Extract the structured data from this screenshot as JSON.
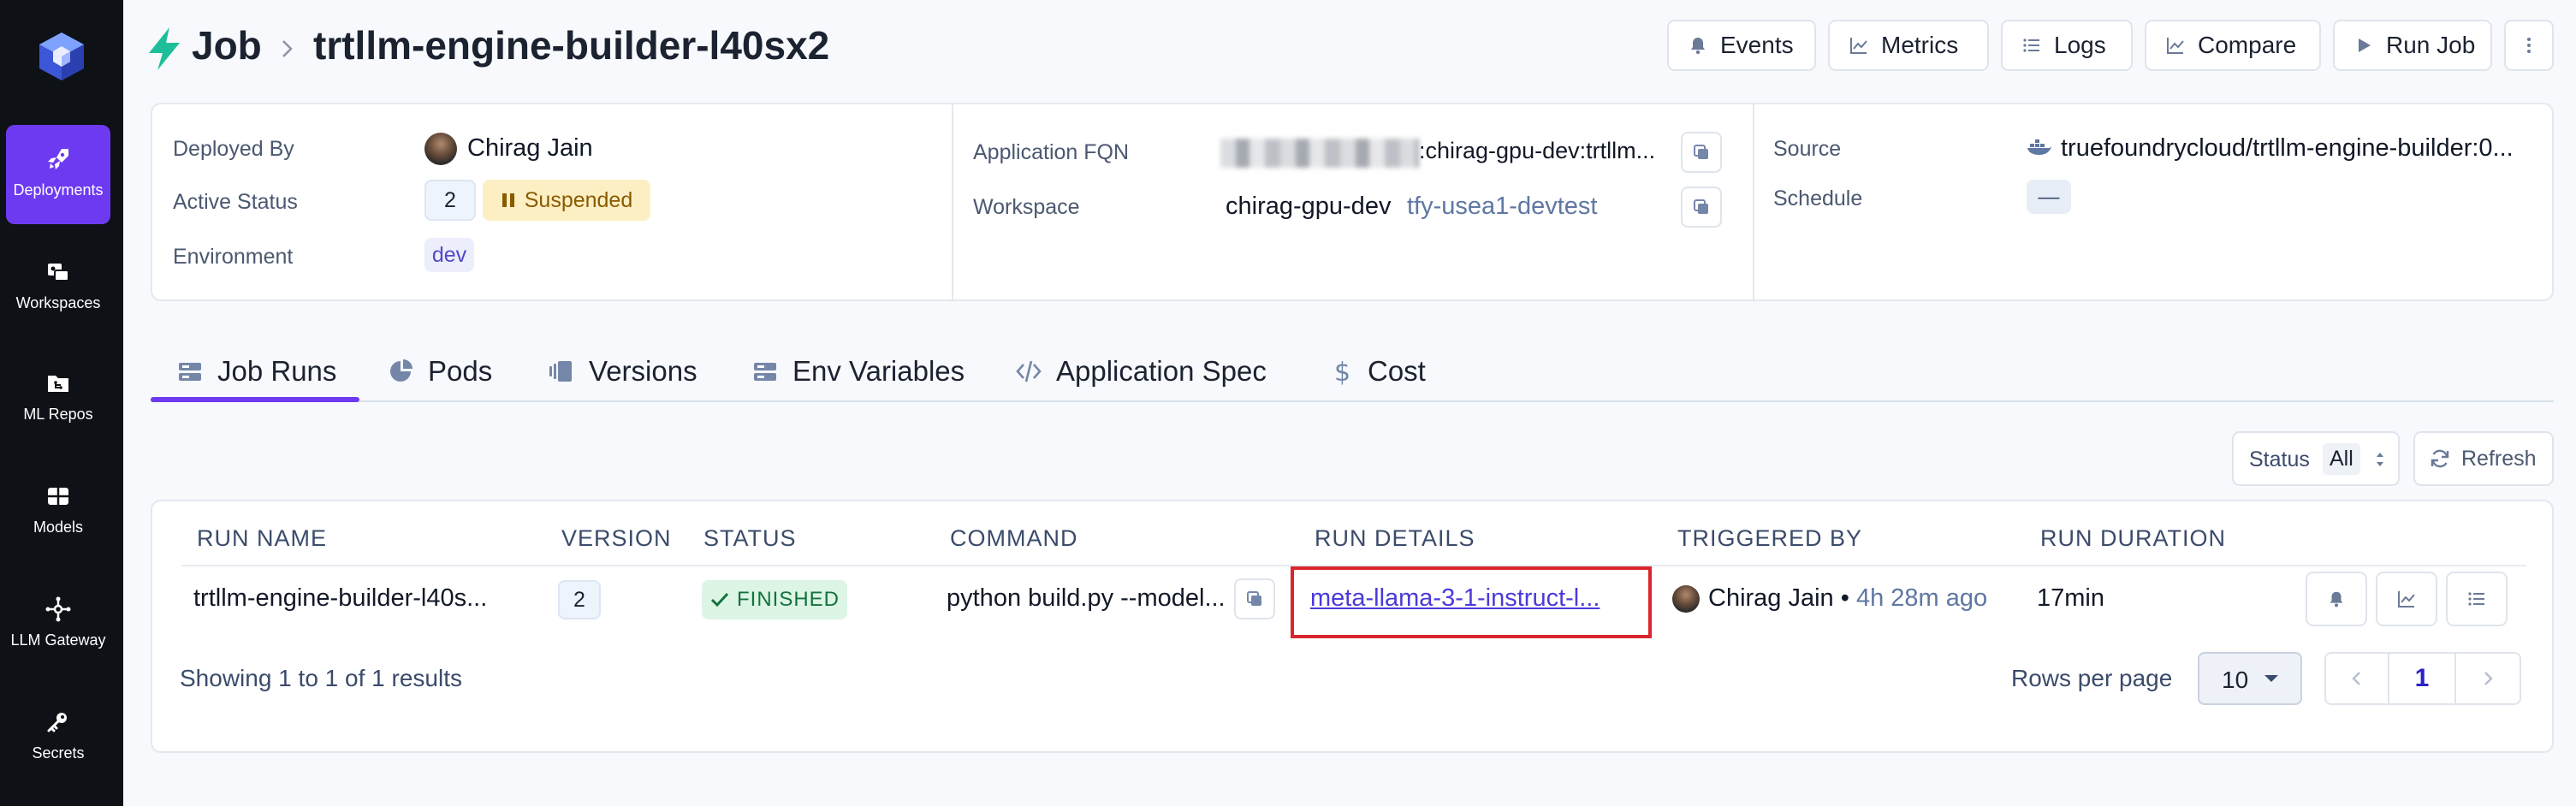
{
  "sidebar": {
    "items": [
      {
        "label": "Deployments",
        "icon": "rocket-icon",
        "active": true
      },
      {
        "label": "Workspaces",
        "icon": "workspaces-icon"
      },
      {
        "label": "ML Repos",
        "icon": "folder-icon"
      },
      {
        "label": "Models",
        "icon": "grid-icon"
      },
      {
        "label": "LLM Gateway",
        "icon": "hub-icon"
      },
      {
        "label": "Secrets",
        "icon": "key-icon"
      }
    ]
  },
  "header": {
    "kind": "Job",
    "name": "trtllm-engine-builder-l40sx2",
    "buttons": {
      "events": "Events",
      "metrics": "Metrics",
      "logs": "Logs",
      "compare": "Compare",
      "run_job": "Run Job"
    }
  },
  "info": {
    "deployed_by_label": "Deployed By",
    "deployed_by": "Chirag Jain",
    "active_status_label": "Active Status",
    "active_version": "2",
    "status_badge": "Suspended",
    "environment_label": "Environment",
    "environment": "dev",
    "fqn_label": "Application FQN",
    "fqn_value": ":chirag-gpu-dev:trtllm...",
    "workspace_label": "Workspace",
    "workspace": "chirag-gpu-dev",
    "cluster": "tfy-usea1-devtest",
    "source_label": "Source",
    "source": "truefoundrycloud/trtllm-engine-builder:0...",
    "schedule_label": "Schedule",
    "schedule": "—"
  },
  "tabs": [
    {
      "label": "Job Runs",
      "active": true
    },
    {
      "label": "Pods"
    },
    {
      "label": "Versions"
    },
    {
      "label": "Env Variables"
    },
    {
      "label": "Application Spec"
    },
    {
      "label": "Cost"
    }
  ],
  "filter": {
    "status_label": "Status",
    "status_value": "All",
    "refresh": "Refresh"
  },
  "table": {
    "columns": [
      "RUN NAME",
      "VERSION",
      "STATUS",
      "COMMAND",
      "RUN DETAILS",
      "TRIGGERED BY",
      "RUN DURATION"
    ],
    "rows": [
      {
        "run_name": "trtllm-engine-builder-l40s...",
        "version": "2",
        "status": "FINISHED",
        "command": "python build.py --model...",
        "run_details": "meta-llama-3-1-instruct-l...",
        "triggered_by": "Chirag Jain",
        "triggered_sep": "•",
        "triggered_ago": "4h 28m ago",
        "duration": "17min"
      }
    ],
    "summary": "Showing 1 to 1 of 1 results",
    "rows_per_page_label": "Rows per page",
    "rows_per_page": "10",
    "current_page": "1"
  },
  "colors": {
    "accent": "#6d3af2",
    "sidebar_bg": "#0e1116",
    "finished_bg": "#dcf5e4",
    "finished_text": "#13723d",
    "suspended_bg": "#fdefc4",
    "suspended_text": "#8a5a00",
    "link": "#4a3bd8",
    "highlight": "#d9262c"
  }
}
